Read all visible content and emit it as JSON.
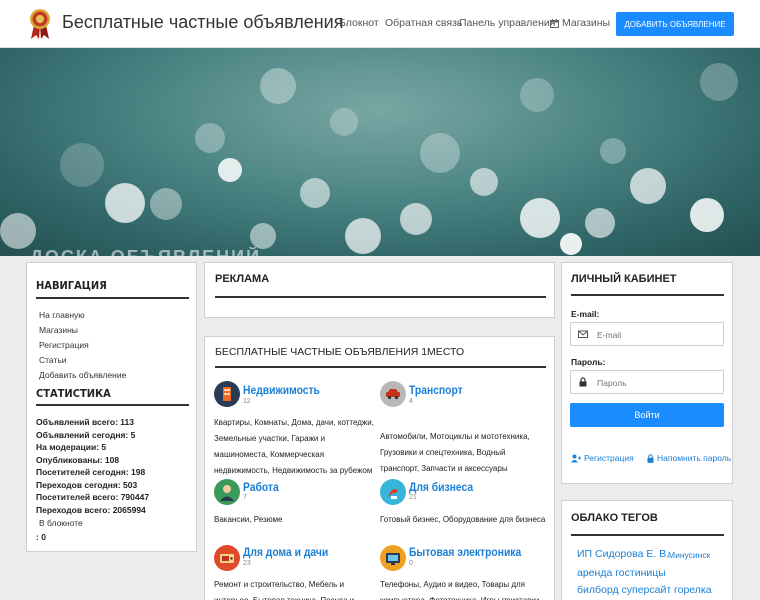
{
  "header": {
    "title": "Бесплатные частные объявления",
    "nav": [
      "Блокнот",
      "Обратная связь",
      "Панель управления",
      "Магазины"
    ],
    "add_button": "Добавить объявление"
  },
  "hero": {
    "ghost_text": "ДОСКА ОБЪЯВЛЕНИЙ"
  },
  "sidebar": {
    "nav_title": "Навигация",
    "nav_items": [
      "На главную",
      "Магазины",
      "Регистрация",
      "Статьи",
      "Добавить объявление"
    ],
    "stats_title": "Статистика",
    "stats": [
      "Объявлений всего: 113",
      "Объявлений сегодня: 5",
      "На модерации: 5",
      "Опубликованы: 108",
      "Посетителей сегодня: 198",
      "Переходов сегодня: 503",
      "Посетителей всего: 790447",
      "Переходов всего: 2065994"
    ],
    "notepad_label": "В блокноте",
    "notepad_count": ": 0"
  },
  "ads": {
    "title": "Реклама"
  },
  "catalog": {
    "title": "Бесплатные частные объявления 1место",
    "categories": [
      {
        "name": "Недвижимость",
        "count": "12",
        "desc": "Квартиры, Комнаты, Дома, дачи, коттеджи, Земельные участки, Гаражи и машиноместа, Коммерческая недвижимость, Недвижимость за рубежом",
        "color": "#2a3b55"
      },
      {
        "name": "Транспорт",
        "count": "4",
        "desc": "Автомобили, Мотоциклы и мототехника, Грузовики и спецтехника, Водный транспорт, Запчасти и аксессуары",
        "color": "#8b8b8b"
      },
      {
        "name": "Работа",
        "count": "7",
        "desc": "Вакансии, Резюме",
        "color": "#3a9a5a"
      },
      {
        "name": "Для бизнеса",
        "count": "21",
        "desc": "Готовый бизнес, Оборудование для бизнеса",
        "color": "#36b6d9"
      },
      {
        "name": "Для дома и дачи",
        "count": "23",
        "desc": "Ремонт и строительство, Мебель и интерьер, Бытовая техника, Посуда и товары для кухни",
        "color": "#e04a2a"
      },
      {
        "name": "Бытовая электроника",
        "count": "0",
        "desc": "Телефоны, Аудио и видео, Товары для компьютера, Фототехника, Игры приставки",
        "color": "#f0a020"
      }
    ]
  },
  "account": {
    "title": "Личный кабинет",
    "email_label": "E-mail:",
    "email_placeholder": "E-mail",
    "password_label": "Пароль:",
    "password_placeholder": "Пароль",
    "login_button": "Войти",
    "register_link": "Регистрация",
    "remind_link": "Напомнить пароль"
  },
  "tags": {
    "title": "Облако тегов",
    "items": [
      "ИП Сидорова Е. В.",
      "Минусинск",
      "аренда гостиницы",
      "билборд суперсайт",
      "горелка"
    ]
  },
  "colors": {
    "accent": "#1a8cff",
    "link": "#1a7fd6"
  }
}
